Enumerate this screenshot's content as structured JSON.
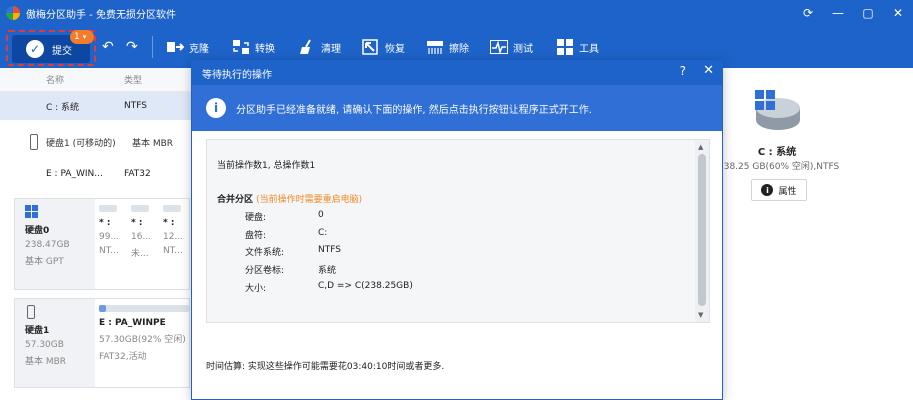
{
  "app": {
    "title": "傲梅分区助手 - 免费无损分区软件"
  },
  "window_controls": {
    "refresh": "⟳",
    "minimize": "—",
    "maximize": "▢",
    "close": "✕"
  },
  "toolbar": {
    "commit_label": "提交",
    "pending_count": "1",
    "items": [
      {
        "label": "克隆"
      },
      {
        "label": "转换"
      },
      {
        "label": "清理"
      },
      {
        "label": "恢复"
      },
      {
        "label": "擦除"
      },
      {
        "label": "测试"
      },
      {
        "label": "工具"
      }
    ]
  },
  "list": {
    "col_name": "名称",
    "col_type": "类型",
    "rows": [
      {
        "name": "C : 系统",
        "type": "NTFS"
      },
      {
        "name": "硬盘1 (可移动的)",
        "type": "基本 MBR"
      },
      {
        "name": "E : PA_WIN...",
        "type": "FAT32"
      }
    ]
  },
  "cards": [
    {
      "disk": "硬盘0",
      "size": "238.47GB",
      "kind": "基本 GPT",
      "parts": [
        {
          "name": "* :",
          "size": "99...",
          "fs": "NT..."
        },
        {
          "name": "* :",
          "size": "16...",
          "fs": "未..."
        },
        {
          "name": "* :",
          "size": "12...",
          "fs": "NT..."
        }
      ]
    },
    {
      "disk": "硬盘1",
      "size": "57.30GB",
      "kind": "基本 MBR",
      "part": {
        "name": "E : PA_WINPE",
        "size": "57.30GB(92% 空闲)",
        "fs": "FAT32,活动"
      }
    }
  ],
  "right": {
    "drive_name": "C : 系统",
    "drive_info": "238.25 GB(60% 空闲),NTFS",
    "props_label": "属性"
  },
  "dialog": {
    "title": "等待执行的操作",
    "help": "?",
    "close": "✕",
    "info_text": "分区助手已经准备就绪, 请确认下面的操作, 然后点击执行按钮让程序正式开工作.",
    "summary": "当前操作数1, 总操作数1",
    "op_title": "合并分区",
    "op_warning": "(当前操作时需要重启电脑)",
    "fields": [
      {
        "key": "硬盘:",
        "value": "0"
      },
      {
        "key": "盘符:",
        "value": "C:"
      },
      {
        "key": "文件系统:",
        "value": "NTFS"
      },
      {
        "key": "分区卷标:",
        "value": "系统"
      },
      {
        "key": "大小:",
        "value": "C,D => C(238.25GB)"
      }
    ],
    "time_estimate": "时间估算: 实现这些操作可能需要花03:40:10时间或者更多."
  }
}
